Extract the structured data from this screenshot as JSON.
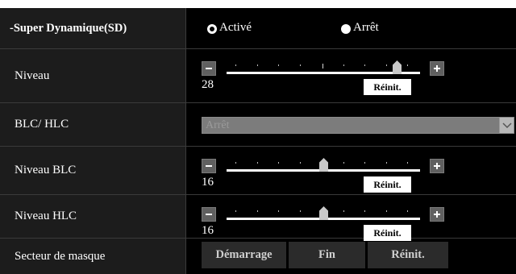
{
  "super_dynamique": {
    "label": "-Super Dynamique(SD)",
    "options": [
      {
        "label": "Activé",
        "checked": true
      },
      {
        "label": "Arrêt",
        "checked": false
      }
    ]
  },
  "niveau": {
    "label": "Niveau",
    "value": "28",
    "position_fraction": 0.88,
    "reset_label": "Réinit."
  },
  "blc_hlc": {
    "label": "BLC/ HLC",
    "selected": "Arrêt",
    "disabled": true
  },
  "niveau_blc": {
    "label": "Niveau BLC",
    "value": "16",
    "position_fraction": 0.5,
    "reset_label": "Réinit."
  },
  "niveau_hlc": {
    "label": "Niveau HLC",
    "value": "16",
    "position_fraction": 0.5,
    "reset_label": "Réinit."
  },
  "secteur_masque": {
    "label": "Secteur de masque",
    "buttons": [
      "Démarrage",
      "Fin",
      "Réinit."
    ]
  },
  "icons": {
    "decrease": "minus-icon",
    "increase": "plus-icon",
    "dropdown": "chevron-down-icon"
  },
  "colors": {
    "panel_bg": "#000000",
    "label_bg": "#1c1c1c",
    "divider": "#3a3a3a",
    "button_bg": "#2b2b2b"
  }
}
